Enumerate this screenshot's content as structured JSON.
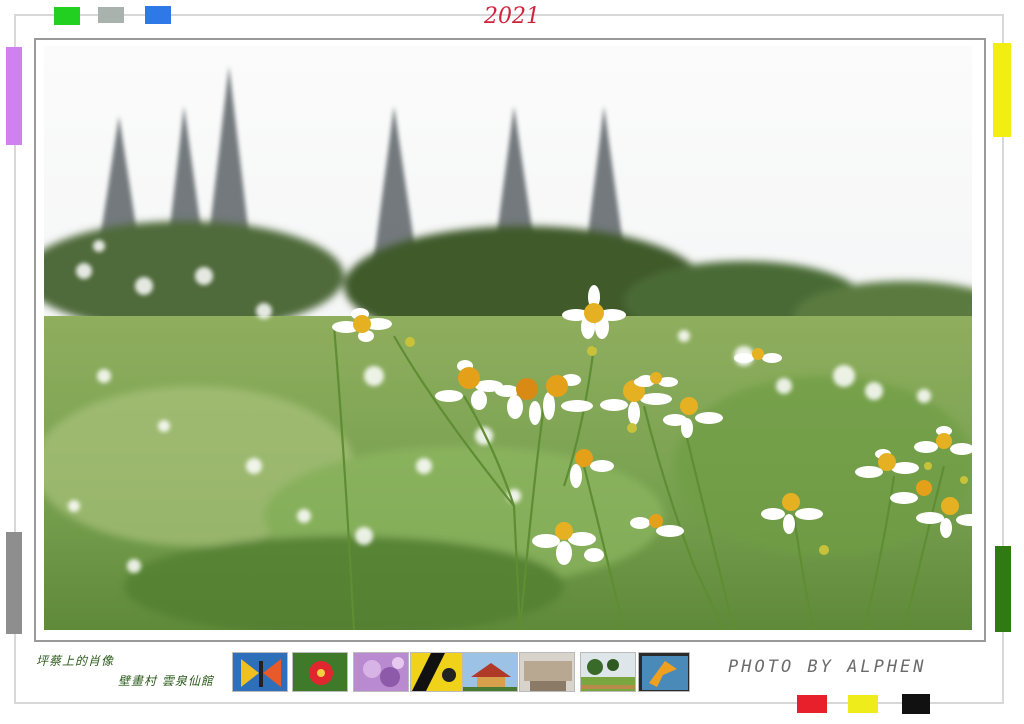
{
  "header": {
    "year": "2021"
  },
  "captions": {
    "line1": "坪蔡上的肖像",
    "line2": "壁畫村 雲泉仙館"
  },
  "credit": "PHOTO BY ALPHEN",
  "colors": {
    "swatch_green": "#22d022",
    "swatch_gray": "#a9b2ad",
    "swatch_blue": "#2f78e8",
    "bar_violet": "#d080ef",
    "bar_yellow": "#f2ee12",
    "bar_gray": "#8e8e8e",
    "bar_darkgreen": "#2f7a12",
    "swatch_red": "#e8202c",
    "swatch_yellow2": "#efec1c",
    "swatch_black": "#111111",
    "year_color": "#d0243c"
  },
  "thumbnails": [
    {
      "name": "butterfly-mural-thumbnail"
    },
    {
      "name": "red-flower-thumbnail"
    },
    {
      "name": "purple-blossom-thumbnail"
    },
    {
      "name": "yellow-car-thumbnail"
    },
    {
      "name": "temple-thumbnail"
    },
    {
      "name": "interior-thumbnail"
    },
    {
      "name": "field-thumbnail"
    },
    {
      "name": "bird-painting-thumbnail"
    }
  ]
}
